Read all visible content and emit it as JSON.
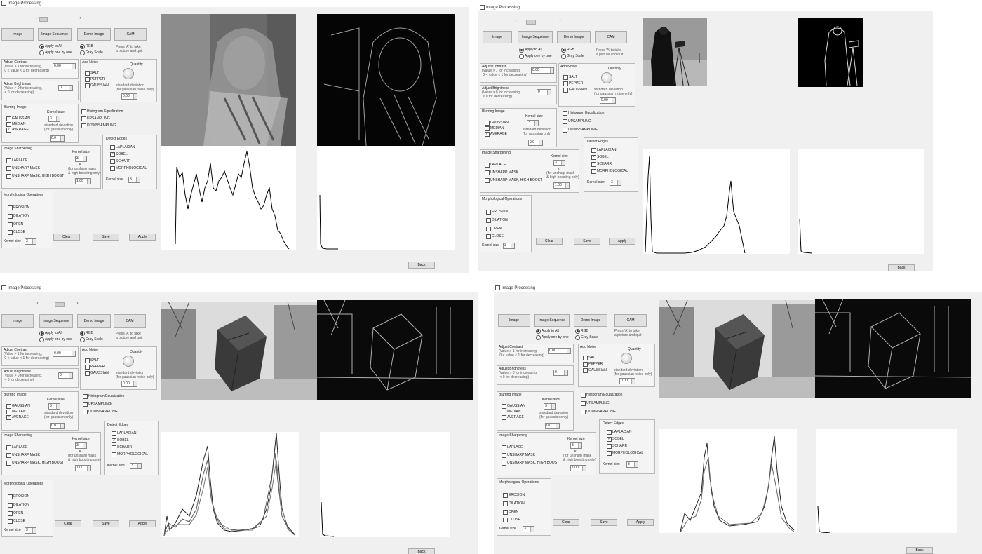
{
  "window": {
    "title": "Image Processing"
  },
  "buttons": {
    "image": "Image",
    "sequence": "Image Sequence",
    "demo": "Demo Image",
    "cam": "CAM",
    "clear": "Clear",
    "save": "Save",
    "apply": "Apply",
    "back": "Back"
  },
  "apply_mode": {
    "all": "Apply to All",
    "one": "Apply one by one"
  },
  "color_mode": {
    "rgb": "RGB",
    "gray": "Gray Scale"
  },
  "cam_hint": "Press 'A' to take\na picture and quit",
  "contrast": {
    "title": "Adjust Contrast",
    "desc": "(Value > 1 for increasing,\n 0 < value < 1 for decreasing)",
    "value": "0.00"
  },
  "brightness": {
    "title": "Adjust Brightness",
    "desc": "(Value > 0 for increasing,\n < 0 for decreasing)",
    "value": "0"
  },
  "noise": {
    "title": "Add Noise",
    "items": [
      "SALT",
      "PEPPER",
      "GAUSSIAN"
    ],
    "quantity": "Quantity",
    "std": "standard deviation\n(for gaussian noise only)",
    "std_value": "0.00"
  },
  "blur": {
    "title": "Blurring Image",
    "items": [
      "GAUSSIAN",
      "MEDIAN",
      "AVERAGE"
    ],
    "kernel": "Kernel size",
    "std": "standard deviation\n(for gaussian only)",
    "kernel_value": "3",
    "std_value": "0.0"
  },
  "options": {
    "histeq": "Histogram Equalization",
    "up": "UPSAMPLING",
    "down": "DOWNSAMPLING"
  },
  "sharpen": {
    "title": "Image Sharpening",
    "items": [
      "LAPLACE",
      "UNSHARP MASK",
      "UNSHARP MASK, HIGH BOOST"
    ],
    "kernel": "Kernel size",
    "k": "k",
    "note": "(for unsharp mask\n& high boosting only)",
    "kernel_value": "3",
    "k_value": "1.00"
  },
  "edges": {
    "title": "Detect Edges",
    "items": [
      "LAPLACIAN",
      "SOBEL",
      "SCHARR",
      "MORPHOLOGICAL"
    ],
    "kernel": "Kernel size",
    "kernel_value": "3"
  },
  "morph": {
    "title": "Morphological Operations",
    "items": [
      "EROSION",
      "DILATION",
      "OPEN",
      "CLOSE"
    ],
    "kernel": "Kernel size",
    "kernel_value": "3"
  },
  "scroll": {
    "left": "‹",
    "right": "›"
  },
  "colors": {
    "bg": "#f0f0f0",
    "panel": "#f4f4f4",
    "border": "#b9b9b9"
  }
}
